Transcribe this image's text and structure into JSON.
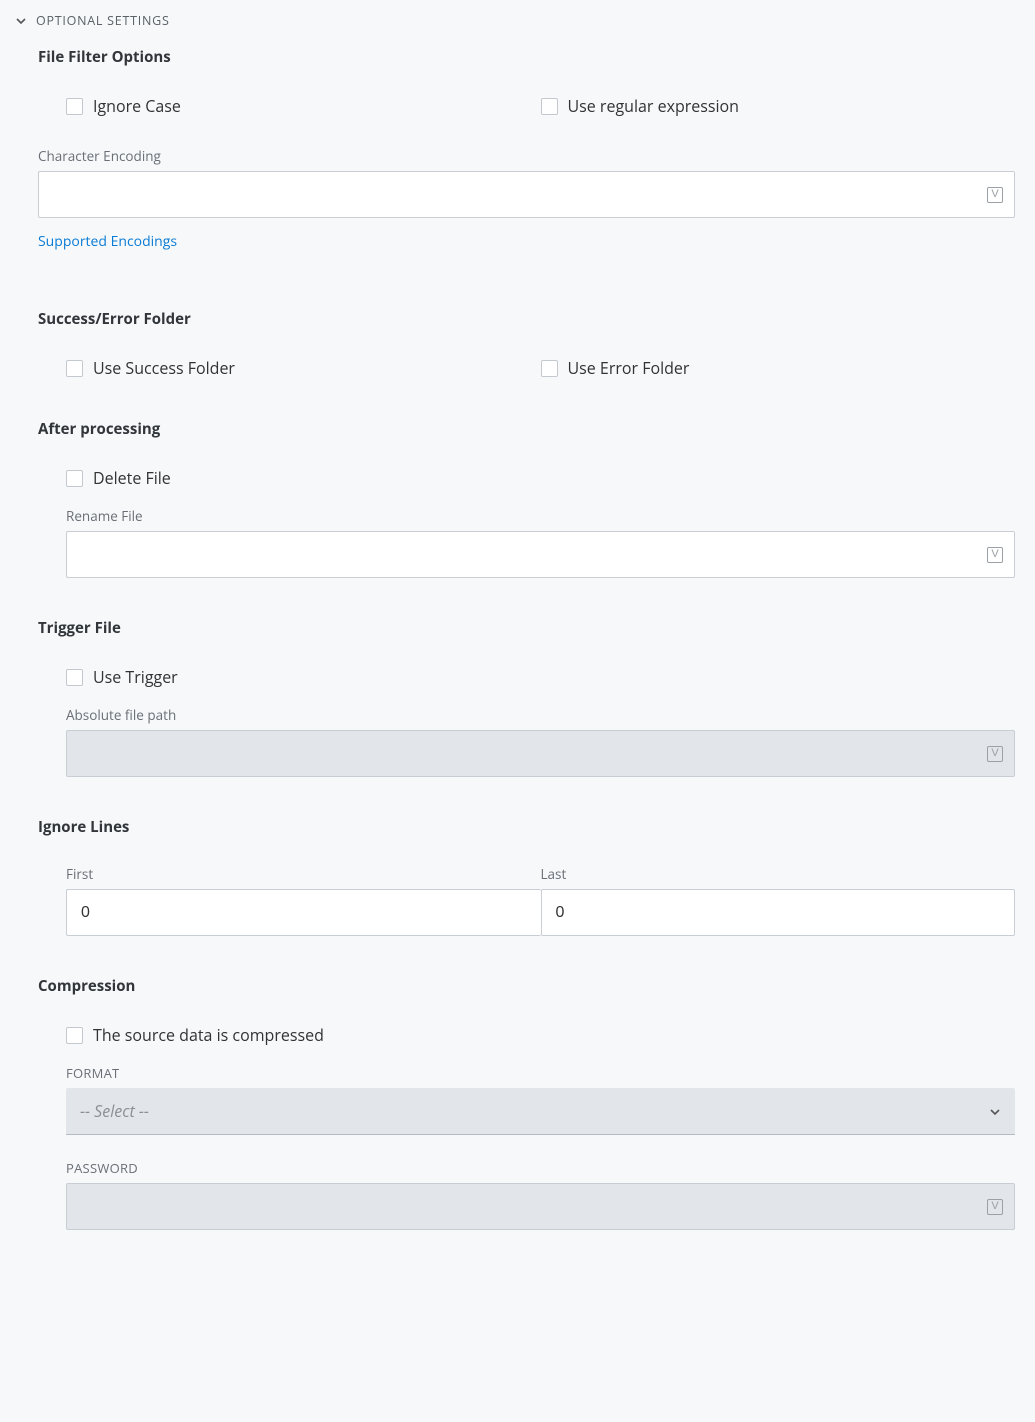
{
  "expander": {
    "title": "OPTIONAL SETTINGS"
  },
  "sections": {
    "fileFilter": {
      "title": "File Filter Options",
      "ignoreCase": "Ignore Case",
      "useRegex": "Use regular expression",
      "charEncodingLabel": "Character Encoding",
      "charEncodingValue": "",
      "supportedLink": "Supported Encodings"
    },
    "successError": {
      "title": "Success/Error Folder",
      "useSuccess": "Use Success Folder",
      "useError": "Use Error Folder"
    },
    "afterProcessing": {
      "title": "After processing",
      "deleteFile": "Delete File",
      "renameLabel": "Rename File",
      "renameValue": ""
    },
    "triggerFile": {
      "title": "Trigger File",
      "useTrigger": "Use Trigger",
      "pathLabel": "Absolute file path",
      "pathValue": ""
    },
    "ignoreLines": {
      "title": "Ignore Lines",
      "firstLabel": "First",
      "firstValue": "0",
      "lastLabel": "Last",
      "lastValue": "0"
    },
    "compression": {
      "title": "Compression",
      "sourceCompressed": "The source data is compressed",
      "formatLabel": "FORMAT",
      "formatPlaceholder": "-- Select --",
      "passwordLabel": "PASSWORD",
      "passwordValue": ""
    }
  }
}
